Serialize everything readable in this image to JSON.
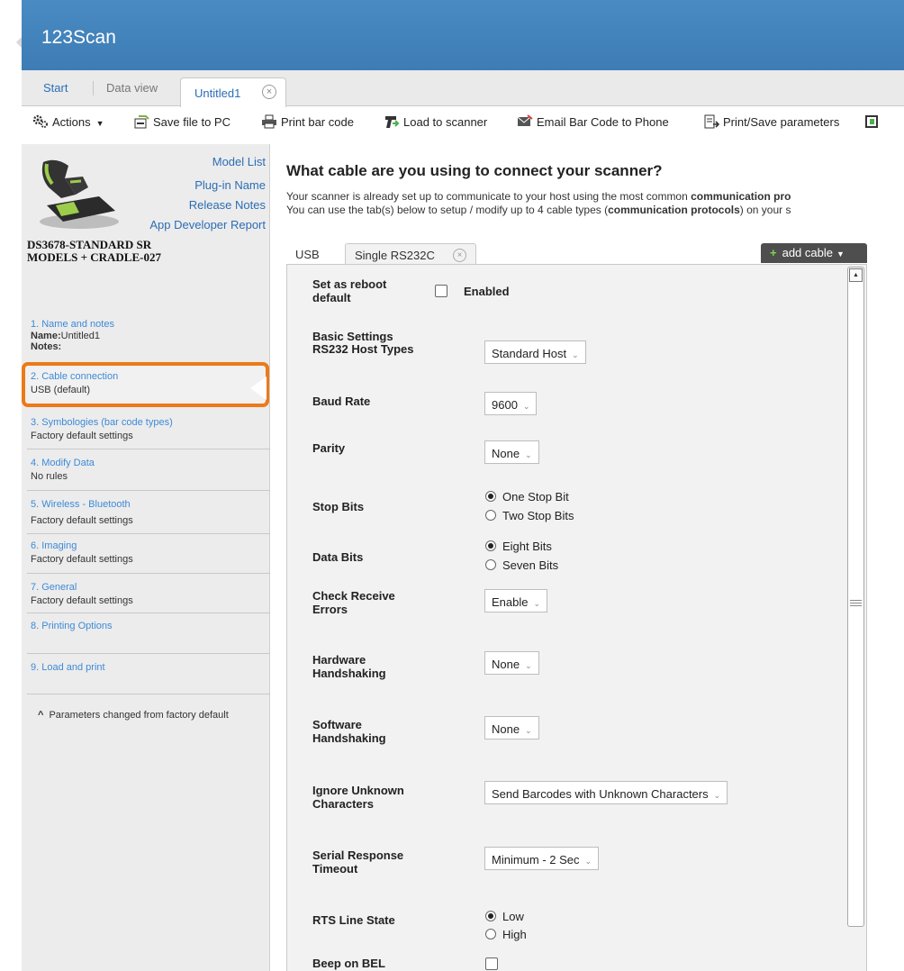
{
  "app": {
    "title": "123Scan"
  },
  "tabs": {
    "start": "Start",
    "data_view": "Data view",
    "active": "Untitled1",
    "close_glyph": "×"
  },
  "toolbar": {
    "actions": "Actions",
    "save": "Save file to PC",
    "print_barcode": "Print bar code",
    "load": "Load to scanner",
    "email": "Email Bar Code to Phone",
    "print_params": "Print/Save parameters"
  },
  "left": {
    "links": {
      "model_list": "Model List",
      "plugin": "Plug-in Name",
      "release_notes": "Release Notes",
      "app_dev": "App Developer Report"
    },
    "model_line1": "DS3678-STANDARD SR",
    "model_line2": "MODELS + CRADLE-027",
    "steps": [
      {
        "title": "1. Name and notes",
        "name_label": "Name:",
        "name_value": "Untitled1",
        "notes_label": "Notes:"
      },
      {
        "title": "2. Cable connection",
        "value": "USB (default)"
      },
      {
        "title": "3. Symbologies (bar code types)",
        "value": "Factory default settings"
      },
      {
        "title": "4. Modify Data",
        "value": "No rules"
      },
      {
        "title": "5. Wireless - Bluetooth",
        "value": "Factory default settings"
      },
      {
        "title": "6. Imaging",
        "value": "Factory default settings"
      },
      {
        "title": "7. General",
        "value": "Factory default settings"
      },
      {
        "title": "8. Printing Options"
      },
      {
        "title": "9. Load and print"
      }
    ],
    "footnote_mark": "^",
    "footnote": "Parameters changed from factory default"
  },
  "main": {
    "question": "What cable are you using to connect your scanner?",
    "desc1_a": "Your scanner is already set up to communicate to your host using the most common ",
    "desc1_b": "communication pro",
    "desc2_a": "You can use the tab(s) below to setup / modify up to 4 cable types (",
    "desc2_b": "communication protocols",
    "desc2_c": ") on your s",
    "cable_tabs": {
      "usb": "USB",
      "rs232": "Single RS232C",
      "add": "add cable"
    },
    "form": {
      "reboot_label": "Set as reboot default",
      "reboot_enabled": "Enabled",
      "basic_heading": "Basic Settings",
      "host_types_label": "RS232 Host Types",
      "host_types_value": "Standard Host",
      "baud_label": "Baud Rate",
      "baud_value": "9600",
      "parity_label": "Parity",
      "parity_value": "None",
      "stop_label": "Stop Bits",
      "stop_opt1": "One Stop Bit",
      "stop_opt2": "Two Stop Bits",
      "data_label": "Data Bits",
      "data_opt1": "Eight Bits",
      "data_opt2": "Seven Bits",
      "cre_label": "Check Receive Errors",
      "cre_value": "Enable",
      "hw_label": "Hardware Handshaking",
      "hw_value": "None",
      "sw_label": "Software Handshaking",
      "sw_value": "None",
      "iuc_label": "Ignore Unknown Characters",
      "iuc_value": "Send Barcodes with Unknown Characters",
      "srt_label": "Serial Response Timeout",
      "srt_value": "Minimum - 2 Sec",
      "rts_label": "RTS Line State",
      "rts_opt1": "Low",
      "rts_opt2": "High",
      "bel_label": "Beep on BEL"
    }
  },
  "colors": {
    "titlebar": "#4a8bc3",
    "link": "#2b6db5",
    "step_title": "#3d8ad8",
    "highlight": "#ec7a19",
    "add_cable_bg": "#4e4e4e"
  }
}
